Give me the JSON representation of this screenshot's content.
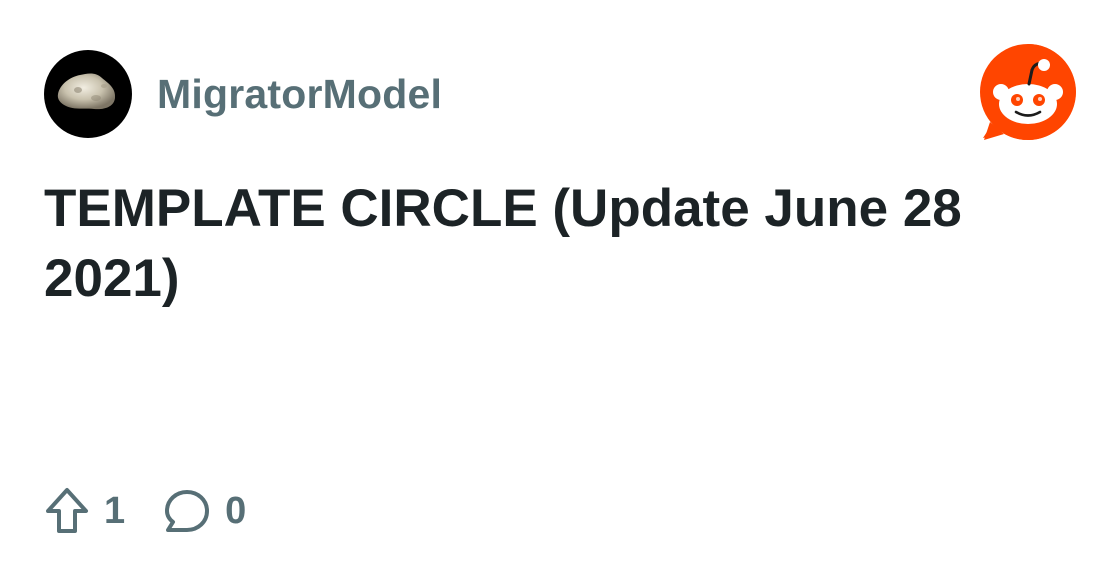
{
  "post": {
    "author": "MigratorModel",
    "title": "TEMPLATE CIRCLE (Update June 28 2021)",
    "upvotes": "1",
    "comments": "0"
  },
  "icons": {
    "avatar": "asteroid-avatar",
    "logo": "reddit-snoo-logo",
    "upvote": "upvote-arrow-icon",
    "comment": "comment-bubble-icon"
  },
  "colors": {
    "brand": "#ff4500",
    "muted_text": "#576f76",
    "title_text": "#1c2326"
  }
}
